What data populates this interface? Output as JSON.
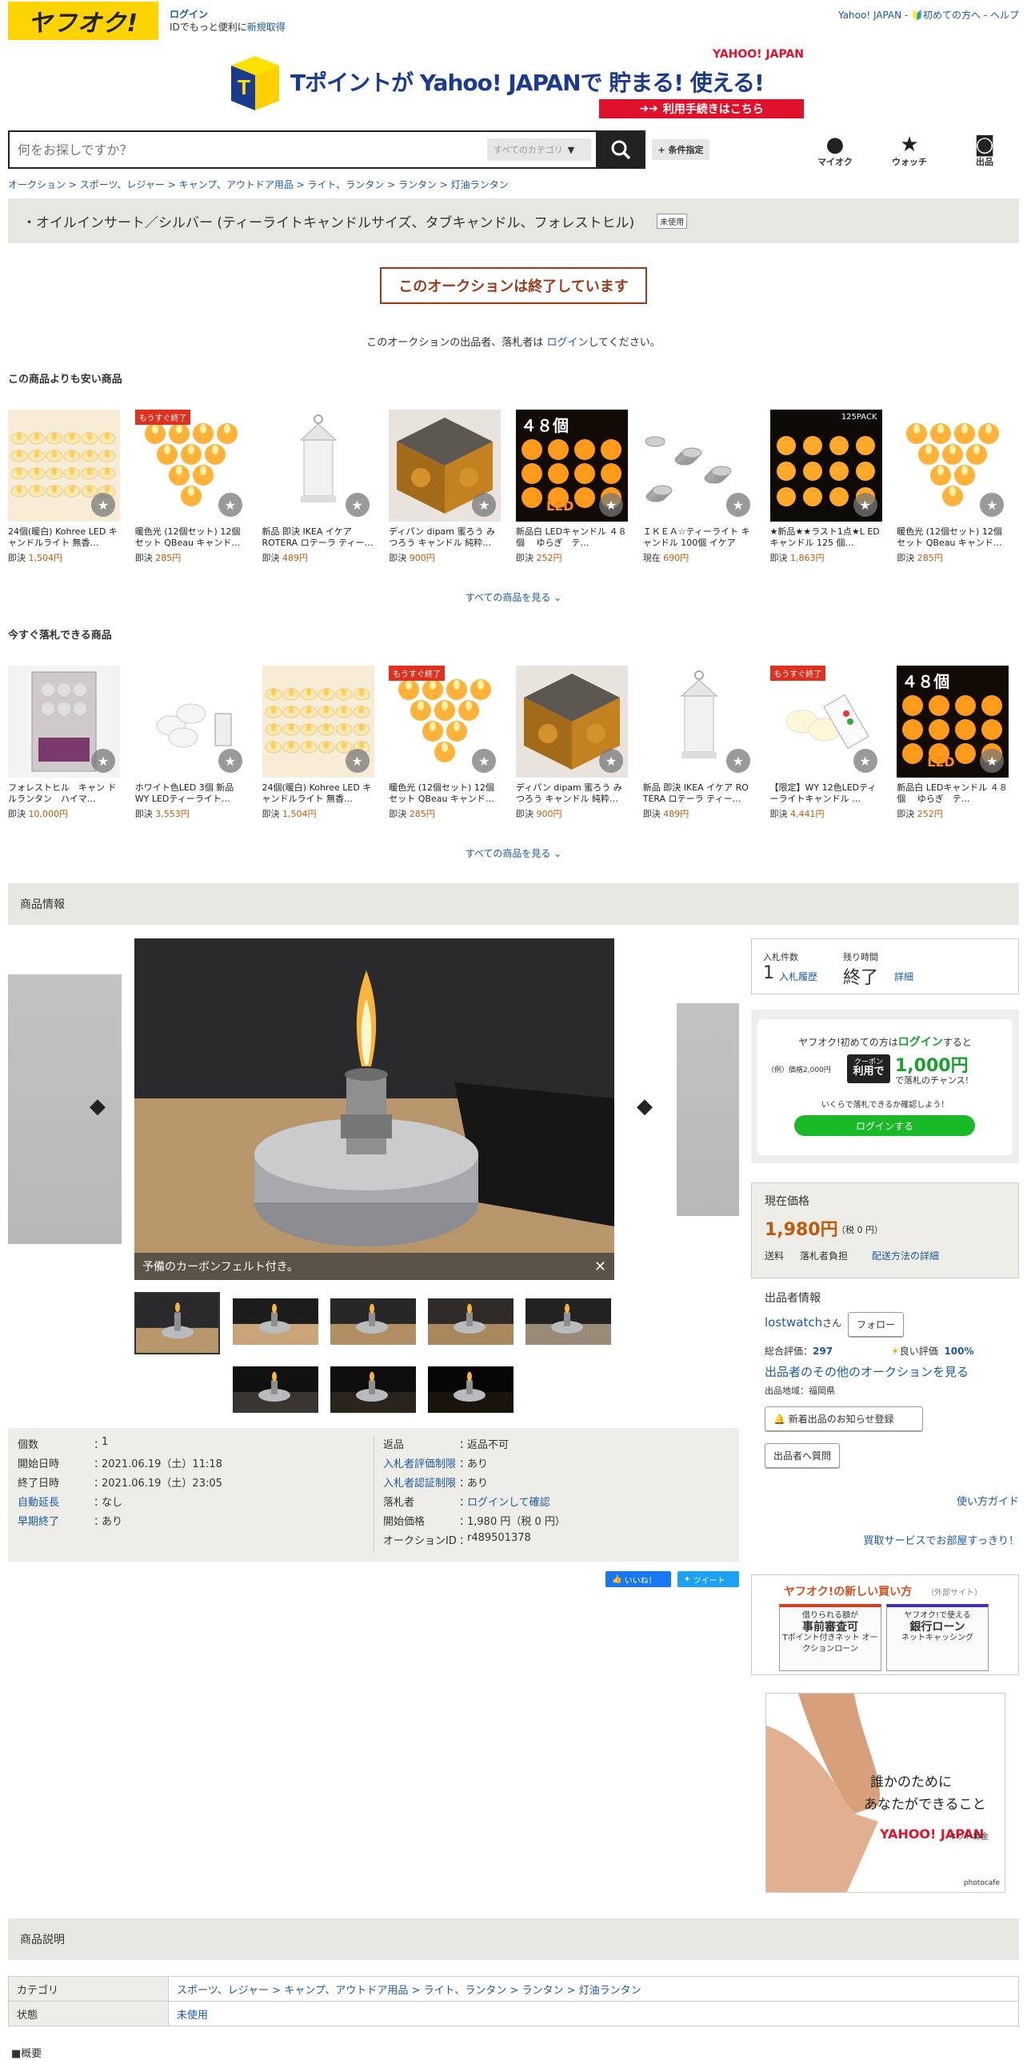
{
  "header": {
    "logo": "ヤフオク!",
    "login": "ログイン",
    "login_sub": "IDでもっと便利に",
    "register": "新規取得",
    "toplinks": "Yahoo! JAPAN - 🔰初めての方へ - ヘルプ"
  },
  "banner": {
    "brand": "YAHOO! JAPAN",
    "headline": "Tポイントが Yahoo! JAPANで 貯まる! 使える!",
    "cta": "利用手続きはこちら",
    "t": "T"
  },
  "search": {
    "placeholder": "何をお探しですか？",
    "category": "すべてのカテゴリ",
    "condition": "+ 条件指定"
  },
  "nav": [
    {
      "label": "マイオク",
      "icon": "person-icon"
    },
    {
      "label": "ウォッチ",
      "icon": "star-icon"
    },
    {
      "label": "出品",
      "icon": "camera-icon"
    }
  ],
  "breadcrumb": "オークション > スポーツ、レジャー > キャンプ、アウトドア用品 > ライト、ランタン > ランタン > 灯油ランタン",
  "title": "・オイルインサート／シルバー (ティーライトキャンドルサイズ、タブキャンドル、フォレストヒル)",
  "condition_badge": "未使用",
  "ended": "このオークションは終了しています",
  "end_msg_pre": "このオークションの出品者、落札者は",
  "end_msg_link": "ログイン",
  "end_msg_post": "してください。",
  "cheaper": {
    "heading": "この商品よりも安い商品",
    "see_all": "すべての商品を見る ⌄",
    "items": [
      {
        "name": "24個(暖白) Kohree LED キャンドルライト 無香…",
        "ptype": "即決",
        "price": "1,504円",
        "img": "tea-lights"
      },
      {
        "name": "暖色光 (12個セット) 12個セット QBeau キャンド…",
        "ptype": "即決",
        "price": "285円",
        "img": "triangle",
        "badge": "もうすぐ終了"
      },
      {
        "name": "新品 即決 IKEA イケア ROTERA ロテーラ ティー…",
        "ptype": "即決",
        "price": "489円",
        "img": "lantern"
      },
      {
        "name": "ディパン dipam 蜜ろう み つろう キャンドル 純粋…",
        "ptype": "即決",
        "price": "900円",
        "img": "beeswax"
      },
      {
        "name": "新品白 LEDキャンドル ４８個　 ゆらぎ　テ…",
        "ptype": "即決",
        "price": "252円",
        "img": "led48",
        "overlay": "４８個",
        "overlay2": "LED"
      },
      {
        "name": "ＩＫＥＡ☆ティーライト キャンドル 100個 イケア",
        "ptype": "現在",
        "price": "690円",
        "img": "silver"
      },
      {
        "name": "★新品★★ラスト1点★L EDキャンドル 125 個…",
        "ptype": "即決",
        "price": "1,863円",
        "img": "led125",
        "pack": "125PACK"
      },
      {
        "name": "暖色光 (12個セット) 12個セット QBeau キャンド…",
        "ptype": "即決",
        "price": "285円",
        "img": "triangle"
      }
    ]
  },
  "buynow": {
    "heading": "今すぐ落札できる商品",
    "see_all": "すべての商品を見る ⌄",
    "items": [
      {
        "name": "フォレストヒル　キャン ドルランタン　ハイマ…",
        "ptype": "即決",
        "price": "10,000円",
        "img": "forest"
      },
      {
        "name": "ホワイト色LED 3個 新品 WY LEDティーライト…",
        "ptype": "即決",
        "price": "3,553円",
        "img": "white3"
      },
      {
        "name": "24個(暖白) Kohree LED キャンドルライト 無香…",
        "ptype": "即決",
        "price": "1,504円",
        "img": "tea-lights"
      },
      {
        "name": "暖色光 (12個セット) 12個セット QBeau キャンド…",
        "ptype": "即決",
        "price": "285円",
        "img": "triangle",
        "badge": "もうすぐ終了"
      },
      {
        "name": "ディパン dipam 蜜ろう み つろう キャンドル 純粋…",
        "ptype": "即決",
        "price": "900円",
        "img": "beeswax"
      },
      {
        "name": "新品 即決 IKEA イケア RO TERA ロテーラ ティー…",
        "ptype": "即決",
        "price": "489円",
        "img": "lantern"
      },
      {
        "name": "【限定】WY 12色LEDティーライトキャンドル …",
        "ptype": "即決",
        "price": "4,441円",
        "img": "remote",
        "badge": "もうすぐ終了"
      },
      {
        "name": "新品白 LEDキャンドル ４８個　 ゆらぎ　テ…",
        "ptype": "即決",
        "price": "252円",
        "img": "led48",
        "overlay": "４８個",
        "overlay2": "LED"
      }
    ]
  },
  "product_info": "商品情報",
  "gallery": {
    "caption": "予備のカーボンフェルト付き。",
    "close": "✕"
  },
  "details_left": [
    {
      "k": "個数",
      "v": "1"
    },
    {
      "k": "開始日時",
      "v": "2021.06.19（土）11:18"
    },
    {
      "k": "終了日時",
      "v": "2021.06.19（土）23:05"
    },
    {
      "k": "自動延長",
      "v": "なし",
      "link": true
    },
    {
      "k": "早期終了",
      "v": "あり",
      "link": true
    }
  ],
  "details_right": [
    {
      "k": "返品",
      "v": "返品不可"
    },
    {
      "k": "入札者評価制限",
      "v": "あり",
      "link": true
    },
    {
      "k": "入札者認証制限",
      "v": "あり",
      "link": true
    },
    {
      "k": "落札者",
      "v": "ログインして確認",
      "vlink": true
    },
    {
      "k": "開始価格",
      "v": "1,980 円（税 0 円）"
    },
    {
      "k": "オークションID",
      "v": "r489501378"
    }
  ],
  "sns": {
    "like": "いいね！",
    "tweet": "ツイート"
  },
  "bids": {
    "count_label": "入札件数",
    "count": "1",
    "history": "入札履歴",
    "time_label": "残り時間",
    "time": "終了",
    "detail": "詳細"
  },
  "promo": {
    "line1_pre": "ヤフオク!初めての方は",
    "line1_link": "ログイン",
    "line1_post": "すると",
    "example": "（例）価格2,000円",
    "coupon_top": "クーポン",
    "coupon_bottom": "利用で",
    "amount": "1,000円",
    "amount_sub": "で落札のチャンス!",
    "note": "いくらで落札できるか確認しよう！",
    "btn": "ログインする"
  },
  "price": {
    "label": "現在価格",
    "value": "1,980円",
    "tax": "（税 0 円）",
    "ship_label": "送料",
    "ship": "落札者負担",
    "ship_link": "配送方法の詳細"
  },
  "seller": {
    "heading": "出品者情報",
    "name": "lostwatch",
    "suffix": "さん",
    "follow": "フォロー",
    "rating_label": "総合評価：",
    "rating": "297",
    "good_label": "良い評価",
    "good": "100%",
    "other": "出品者のその他のオークションを見る",
    "region": "出品地域：福岡県",
    "notify": "新着出品のお知らせ登録",
    "question": "出品者へ質問"
  },
  "guide": "使い方ガイド",
  "room": "買取サービスでお部屋すっきり！",
  "newbuy": {
    "title": "ヤフオク!の新しい買い方",
    "sub": "（外部サイト）",
    "b1_top": "借りられる額が",
    "b1_main": "事前審査可",
    "b1_sub": "Tポイント付きネット オークションローン",
    "b2_top": "ヤフオク!で使える",
    "b2_main": "銀行ローン",
    "b2_sub": "ネットキャッシング"
  },
  "ad": {
    "text1": "誰かのために",
    "text2": "あなたができること",
    "brand": "YAHOO! JAPAN",
    "brand_sub": "ネット募金",
    "credit": "photocafe"
  },
  "desc": {
    "heading": "商品説明",
    "rows": [
      {
        "k": "カテゴリ",
        "v": "スポーツ、レジャー > キャンプ、アウトドア用品 > ライト、ランタン > ランタン > 灯油ランタン"
      },
      {
        "k": "状態",
        "v": "未使用"
      }
    ],
    "overview": "■概要"
  }
}
